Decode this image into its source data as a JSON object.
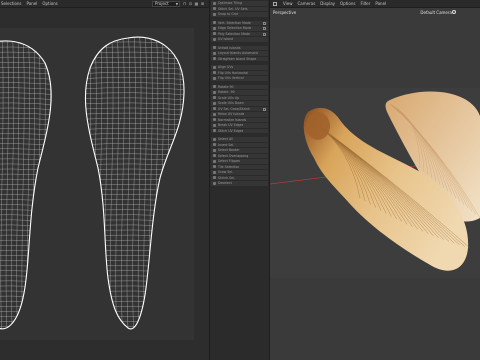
{
  "uv_editor": {
    "menus": [
      "Selections",
      "Panel",
      "Options"
    ],
    "projection_value": "Project",
    "tool_icons": [
      "lock-icon",
      "align-icon",
      "grid-icon",
      "fit-icon"
    ]
  },
  "tool_panel": {
    "groups": [
      {
        "items": [
          {
            "label": "Optimize Tiling"
          },
          {
            "label": "Stitch Sel. UV Sets"
          },
          {
            "label": "Snap to Grid"
          }
        ]
      },
      {
        "items": [
          {
            "label": "Vert. Selection Mode"
          },
          {
            "label": "Edge Selection Mode"
          },
          {
            "label": "Poly Selection Mode"
          },
          {
            "label": "UV Island"
          }
        ]
      },
      {
        "items": [
          {
            "label": "Unfold Islands"
          },
          {
            "label": "Layout Islands Automatic"
          },
          {
            "label": "Straighten Island Shape"
          }
        ]
      },
      {
        "items": [
          {
            "label": "Align UVs"
          },
          {
            "label": "Flip UVs Horizontal"
          },
          {
            "label": "Flip UVs Vertical"
          }
        ]
      },
      {
        "items": [
          {
            "label": "Rotate 90"
          },
          {
            "label": "Rotate -90"
          },
          {
            "label": "Scale UVs Up"
          },
          {
            "label": "Scale UVs Down"
          },
          {
            "label": "UV Sel. Grow/Shrink"
          },
          {
            "label": "Relax UV Islands"
          },
          {
            "label": "Normalize Islands"
          },
          {
            "label": "Break UV Edges"
          },
          {
            "label": "Stitch UV Edges"
          }
        ]
      },
      {
        "items": [
          {
            "label": "Select All"
          },
          {
            "label": "Invert Sel."
          },
          {
            "label": "Select Border"
          },
          {
            "label": "Select Overlapping"
          },
          {
            "label": "Select Flipped"
          },
          {
            "label": "Tile Selection"
          },
          {
            "label": "Grow Sel."
          },
          {
            "label": "Shrink Sel."
          },
          {
            "label": "Deselect"
          }
        ]
      }
    ]
  },
  "viewport": {
    "menus": [
      "View",
      "Cameras",
      "Display",
      "Options",
      "Filter",
      "Panel"
    ],
    "view_label": "Perspective",
    "camera_label": "Default Camera"
  },
  "colors": {
    "uv_background": "#2d2d2d",
    "uv_wire": "#d8d8d8",
    "viewport_background": "#3a3a3a",
    "axis_red": "#b33a3a",
    "seed_orange": "#c98a3a",
    "seed_light": "#e8c89a"
  }
}
